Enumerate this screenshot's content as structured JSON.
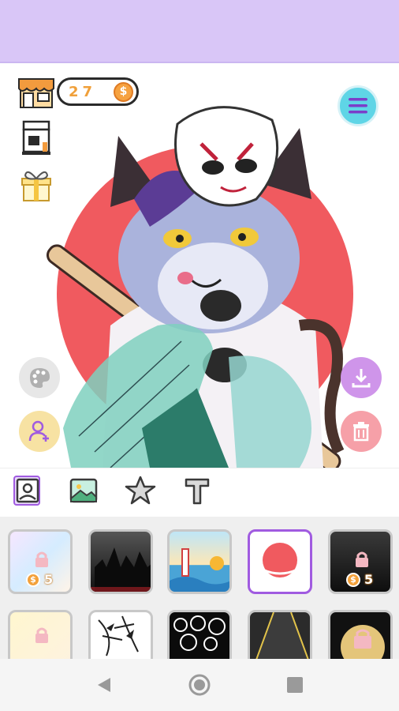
{
  "header": {
    "coins": "27",
    "coin_symbol": "$"
  },
  "toolbar_left": {
    "shop_icon": "shop-icon",
    "machine_icon": "coffee-machine-icon",
    "gift_icon": "gift-icon",
    "palette_icon": "palette-icon",
    "add_character_icon": "add-person-icon"
  },
  "toolbar_right": {
    "menu_icon": "menu-icon",
    "download_icon": "download-icon",
    "delete_icon": "trash-icon"
  },
  "tabs": [
    "character-tab",
    "background-tab",
    "sticker-tab",
    "text-tab"
  ],
  "backgrounds": [
    {
      "name": "pastel-sparkle",
      "locked": true,
      "price": "5",
      "coin_symbol": "$"
    },
    {
      "name": "dark-castle",
      "locked": false
    },
    {
      "name": "seaside-lighthouse",
      "locked": false
    },
    {
      "name": "red-sun",
      "locked": false,
      "selected": true
    },
    {
      "name": "night-scene",
      "locked": true,
      "price": "5",
      "coin_symbol": "$"
    },
    {
      "name": "cream-pattern",
      "locked": true
    },
    {
      "name": "bamboo",
      "locked": false
    },
    {
      "name": "bubbles",
      "locked": false
    },
    {
      "name": "road",
      "locked": false
    },
    {
      "name": "moon",
      "locked": true
    }
  ],
  "colors": {
    "topbar": "#d9c6f7",
    "accent_purple": "#a05be0",
    "sun_red": "#f05a5f",
    "coin_orange": "#f3a13b"
  }
}
